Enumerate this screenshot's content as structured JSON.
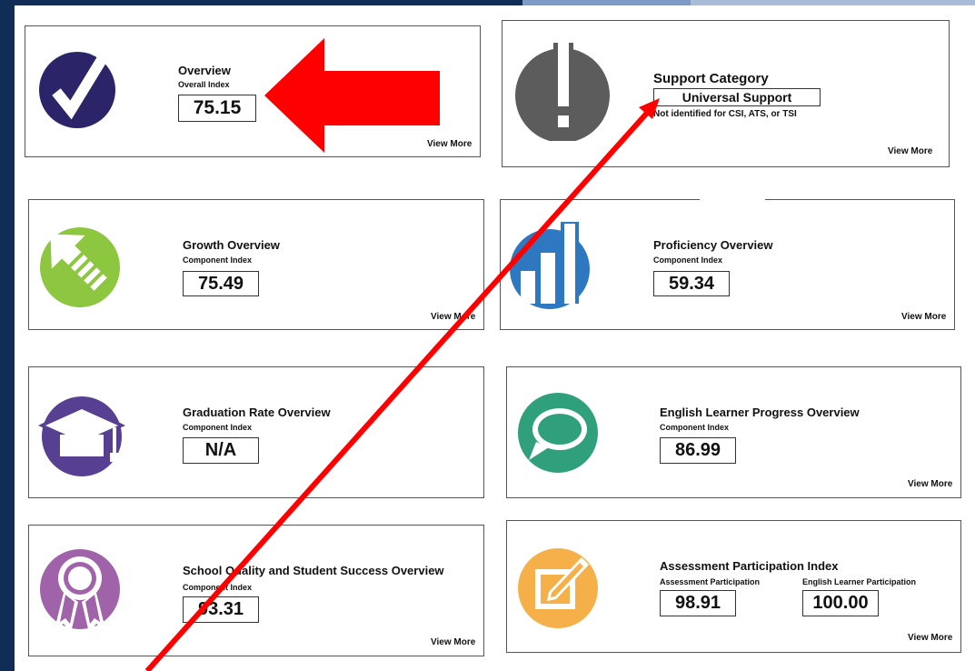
{
  "cards": {
    "overview": {
      "title": "Overview",
      "sub": "Overall Index",
      "value": "75.15",
      "view_more": "View More",
      "icon": "checkmark-icon"
    },
    "support": {
      "title": "Support Category",
      "value": "Universal Support",
      "note": "Not identified for CSI, ATS, or TSI",
      "view_more": "View More",
      "icon": "exclamation-icon"
    },
    "growth": {
      "title": "Growth Overview",
      "sub": "Component Index",
      "value": "75.49",
      "view_more": "View More",
      "icon": "growth-arrow-icon"
    },
    "proficiency": {
      "title": "Proficiency Overview",
      "sub": "Component Index",
      "value": "59.34",
      "view_more": "View More",
      "icon": "bar-chart-icon"
    },
    "graduation": {
      "title": "Graduation Rate Overview",
      "sub": "Component Index",
      "value": "N/A",
      "icon": "graduation-cap-icon"
    },
    "english": {
      "title": "English Learner Progress Overview",
      "sub": "Component Index",
      "value": "86.99",
      "view_more": "View More",
      "icon": "speech-bubble-icon"
    },
    "quality": {
      "title": "School Quality and Student Success Overview",
      "sub": "Component Index",
      "value": "93.31",
      "view_more": "View More",
      "icon": "award-ribbon-icon"
    },
    "assessment": {
      "title": "Assessment Participation Index",
      "sub1": "Assessment Participation",
      "value1": "98.91",
      "sub2": "English Learner Participation",
      "value2": "100.00",
      "view_more": "View More",
      "icon": "pencil-square-icon"
    }
  },
  "colors": {
    "background_navy": "#0f2d57",
    "overview_icon": "#2b2469",
    "support_icon": "#5c5c5c",
    "growth_icon": "#8dc63f",
    "proficiency_icon": "#2e78c2",
    "graduation_icon": "#573f91",
    "english_icon": "#2f9f7c",
    "quality_icon": "#a062a8",
    "assessment_icon": "#f6b04a",
    "annotation_arrow": "#ff0000"
  }
}
